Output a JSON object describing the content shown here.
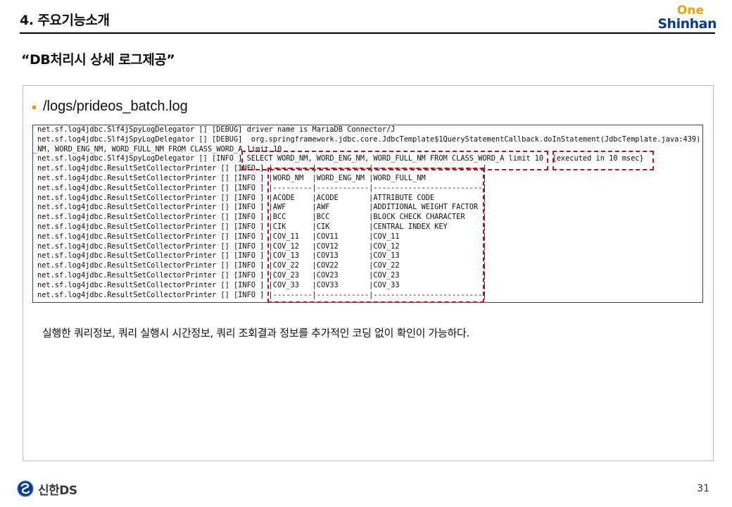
{
  "header": {
    "title": "4. 주요기능소개",
    "logo_top": "One",
    "logo_bottom": "Shinhan"
  },
  "subtitle": "“DB처리시 상세 로그제공”",
  "bullet": {
    "text": "/logs/prideos_batch.log"
  },
  "log_lines": [
    "net.sf.log4jdbc.Slf4jSpyLogDelegator [] [DEBUG] driver name is MariaDB Connector/J",
    "net.sf.log4jdbc.Slf4jSpyLogDelegator [] [DEBUG]  org.springframework.jdbc.core.JdbcTemplate$1QueryStatementCallback.doInStatement(JdbcTemplate.java:439)",
    "_NM, WORD_ENG_NM, WORD_FULL_NM FROM CLASS_WORD_A limit 10",
    "net.sf.log4jdbc.Slf4jSpyLogDelegator [] [INFO ] SELECT WORD_NM, WORD_ENG_NM, WORD_FULL_NM FROM CLASS_WORD_A limit 10  {executed in 10 msec}",
    "net.sf.log4jdbc.ResultSetCollectorPrinter [] [INFO ] |---------|------------|-------------------------|",
    "net.sf.log4jdbc.ResultSetCollectorPrinter [] [INFO ] |WORD_NM  |WORD_ENG_NM |WORD_FULL_NM             |",
    "net.sf.log4jdbc.ResultSetCollectorPrinter [] [INFO ] |---------|------------|-------------------------|",
    "net.sf.log4jdbc.ResultSetCollectorPrinter [] [INFO ] |ACODE    |ACODE       |ATTRIBUTE CODE           |",
    "net.sf.log4jdbc.ResultSetCollectorPrinter [] [INFO ] |AWF      |AWF         |ADDITIONAL WEIGHT FACTOR |",
    "net.sf.log4jdbc.ResultSetCollectorPrinter [] [INFO ] |BCC      |BCC         |BLOCK CHECK CHARACTER    |",
    "net.sf.log4jdbc.ResultSetCollectorPrinter [] [INFO ] |CIK      |CIK         |CENTRAL INDEX KEY        |",
    "net.sf.log4jdbc.ResultSetCollectorPrinter [] [INFO ] |COV_11   |COV11       |COV_11                   |",
    "net.sf.log4jdbc.ResultSetCollectorPrinter [] [INFO ] |COV_12   |COV12       |COV_12                   |",
    "net.sf.log4jdbc.ResultSetCollectorPrinter [] [INFO ] |COV_13   |COV13       |COV_13                   |",
    "net.sf.log4jdbc.ResultSetCollectorPrinter [] [INFO ] |COV_22   |COV22       |COV_22                   |",
    "net.sf.log4jdbc.ResultSetCollectorPrinter [] [INFO ] |COV_23   |COV23       |COV_23                   |",
    "net.sf.log4jdbc.ResultSetCollectorPrinter [] [INFO ] |COV_33   |COV33       |COV_33                   |",
    "net.sf.log4jdbc.ResultSetCollectorPrinter [] [INFO ] |---------|------------|-------------------------|"
  ],
  "description": "실행한 쿼리정보, 쿼리 실행시 시간정보,  쿼리 조회결과 정보를 추가적인 코딩 없이 확인이 가능하다.",
  "footer": {
    "logo_text": "신한DS",
    "page_number": "31"
  },
  "colors": {
    "highlight": "#b71c1c",
    "bullet": "#d19a3a",
    "logo_one": "#e8a21b",
    "logo_shinhan": "#0b3b8c"
  }
}
